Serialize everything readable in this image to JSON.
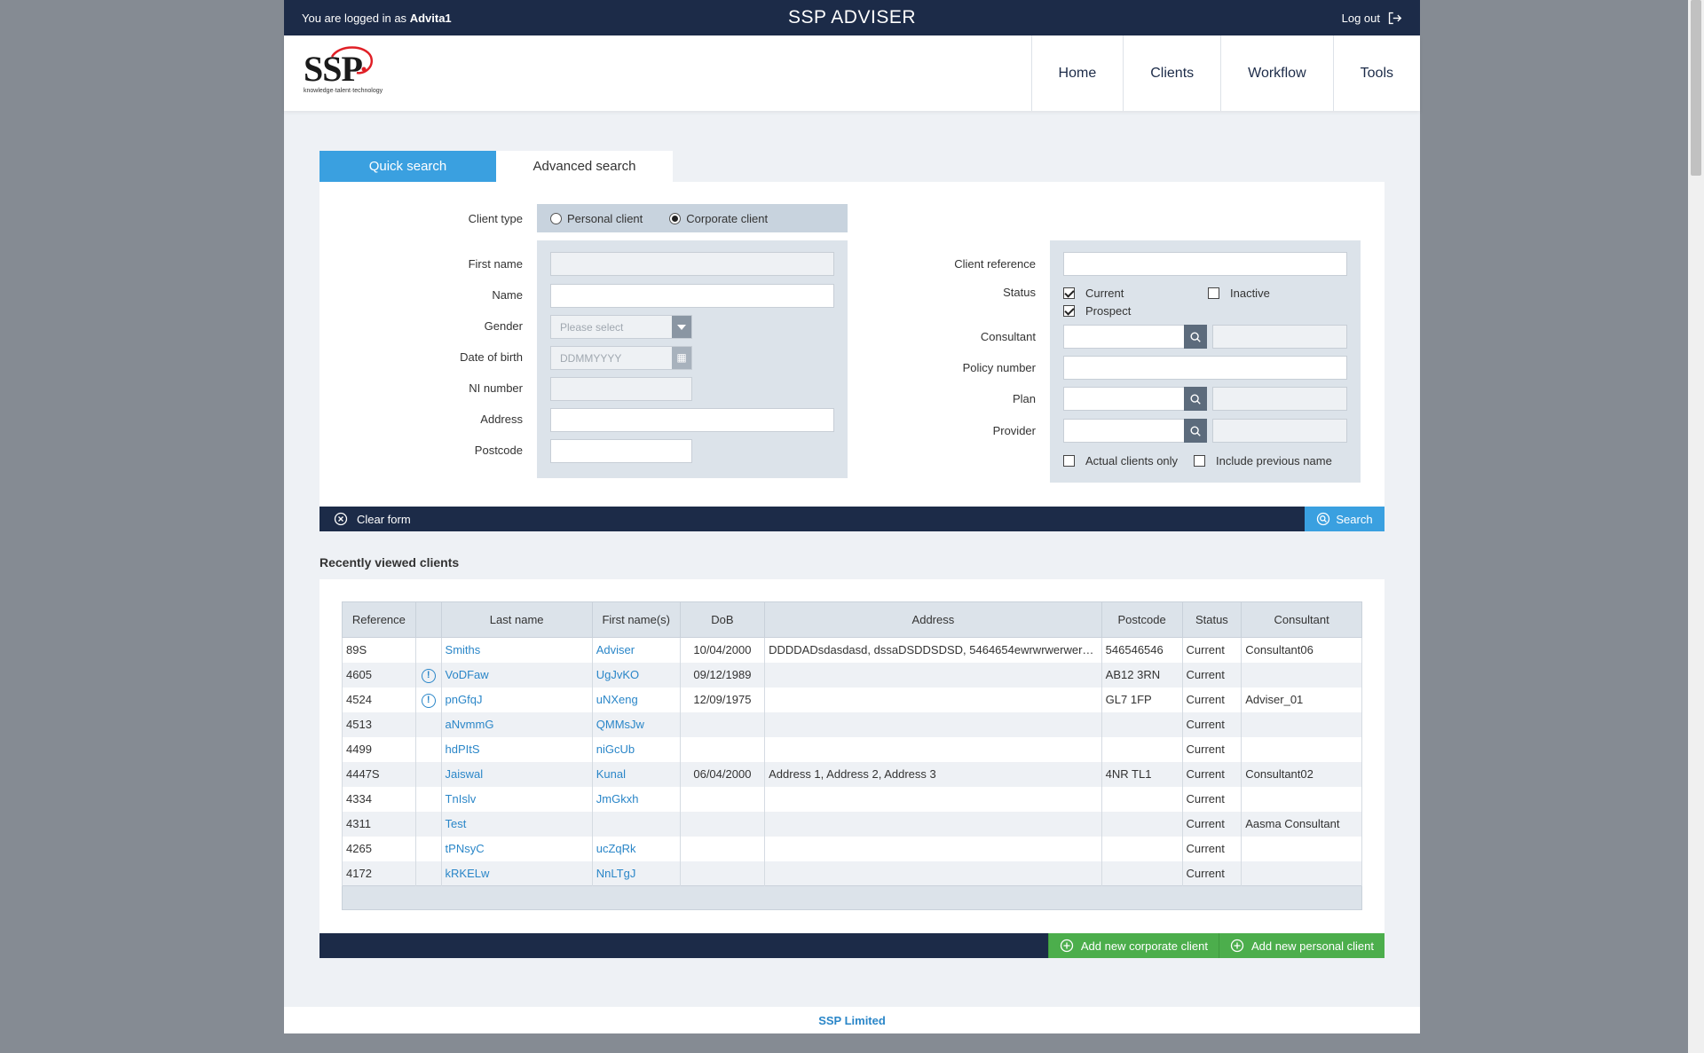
{
  "topbar": {
    "logged_in_prefix": "You are logged in as",
    "username": "Advita1",
    "app_title": "SSP ADVISER",
    "logout_label": "Log out"
  },
  "logo": {
    "word": "SSP",
    "tagline": "knowledge·talent·technology"
  },
  "nav": {
    "items": [
      "Home",
      "Clients",
      "Workflow",
      "Tools"
    ]
  },
  "tabs": {
    "quick": "Quick search",
    "advanced": "Advanced search"
  },
  "form": {
    "client_type_label": "Client type",
    "personal_client": "Personal client",
    "corporate_client": "Corporate client",
    "first_name_label": "First name",
    "name_label": "Name",
    "gender_label": "Gender",
    "gender_placeholder": "Please select",
    "dob_label": "Date of birth",
    "dob_placeholder": "DDMMYYYY",
    "ni_label": "NI number",
    "address_label": "Address",
    "postcode_label": "Postcode",
    "client_ref_label": "Client reference",
    "status_label": "Status",
    "status_current": "Current",
    "status_inactive": "Inactive",
    "status_prospect": "Prospect",
    "consultant_label": "Consultant",
    "policy_label": "Policy number",
    "plan_label": "Plan",
    "provider_label": "Provider",
    "actual_clients_only": "Actual clients only",
    "include_previous_name": "Include previous name"
  },
  "actions": {
    "clear_form": "Clear form",
    "search": "Search"
  },
  "recent": {
    "title": "Recently viewed clients",
    "columns": [
      "Reference",
      "",
      "Last name",
      "First name(s)",
      "DoB",
      "Address",
      "Postcode",
      "Status",
      "Consultant"
    ],
    "rows": [
      [
        "89S",
        "",
        "Smiths",
        "Adviser",
        "10/04/2000",
        "DDDDADsdasdasd, dssaDSDDSDSD, 5464654ewrwrwerwerwer",
        "546546546",
        "Current",
        "Consultant06"
      ],
      [
        "4605",
        "!",
        "VoDFaw",
        "UgJvKO",
        "09/12/1989",
        "",
        "AB12 3RN",
        "Current",
        ""
      ],
      [
        "4524",
        "!",
        "pnGfqJ",
        "uNXeng",
        "12/09/1975",
        "",
        "GL7 1FP",
        "Current",
        "Adviser_01"
      ],
      [
        "4513",
        "",
        "aNvmmG",
        "QMMsJw",
        "",
        "",
        "",
        "Current",
        ""
      ],
      [
        "4499",
        "",
        "hdPItS",
        "niGcUb",
        "",
        "",
        "",
        "Current",
        ""
      ],
      [
        "4447S",
        "",
        "Jaiswal",
        "Kunal",
        "06/04/2000",
        "Address 1, Address 2, Address 3",
        "4NR TL1",
        "Current",
        "Consultant02"
      ],
      [
        "4334",
        "",
        "TnIslv",
        "JmGkxh",
        "",
        "",
        "",
        "Current",
        ""
      ],
      [
        "4311",
        "",
        "Test",
        "",
        "",
        "",
        "",
        "Current",
        "Aasma Consultant"
      ],
      [
        "4265",
        "",
        "tPNsyC",
        "ucZqRk",
        "",
        "",
        "",
        "Current",
        ""
      ],
      [
        "4172",
        "",
        "kRKELw",
        "NnLTgJ",
        "",
        "",
        "",
        "Current",
        ""
      ]
    ]
  },
  "bottom_actions": {
    "add_corporate": "Add new corporate client",
    "add_personal": "Add new personal client"
  },
  "footer": {
    "company": "SSP Limited"
  },
  "colors": {
    "navy": "#1c2b48",
    "blue": "#3aa0e0",
    "green": "#4cae4c",
    "link": "#2a86c8"
  },
  "icons": [
    "logout-icon",
    "search-icon",
    "clear-icon",
    "calendar-icon",
    "chevron-down-icon",
    "plus-icon",
    "warning-icon"
  ]
}
